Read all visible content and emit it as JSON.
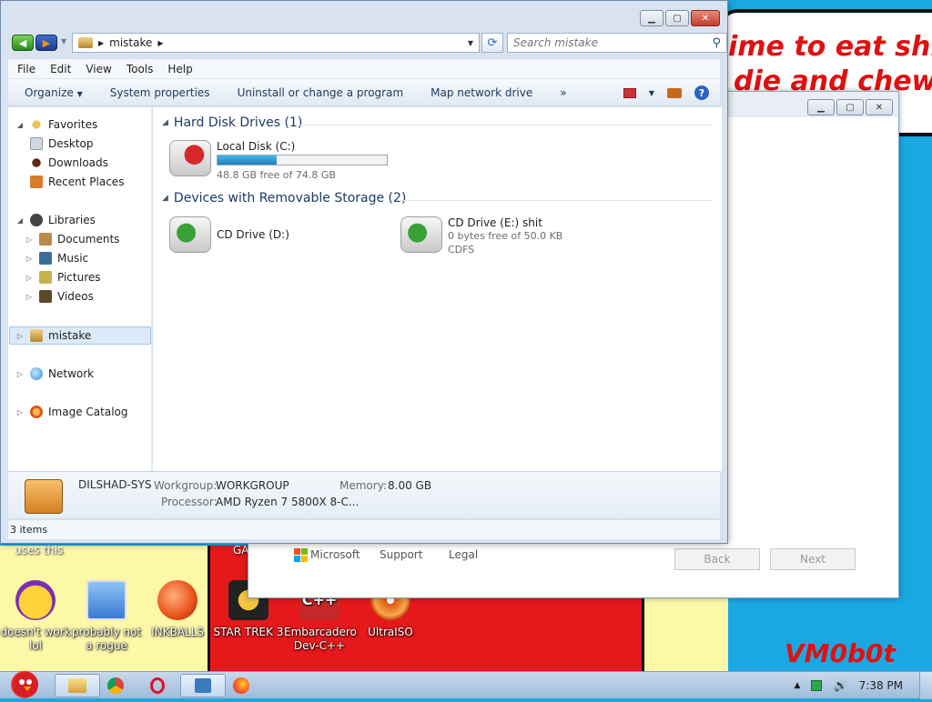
{
  "desktop": {
    "wallpaper_text_line1": "ime to eat shit",
    "wallpaper_text_line2": "die and chew",
    "watermark": "VM0b0t",
    "partial_label_left": "uses this",
    "partial_label_mid": "GA",
    "icons": [
      {
        "label": "doesn't work lol",
        "icon": "yahoo-messenger-icon",
        "color": "#7b2fb3"
      },
      {
        "label": "probably not a rogue",
        "icon": "gear-monitor-icon",
        "color": "#3a7bd5"
      },
      {
        "label": "INKBALLS",
        "icon": "inkball-icon",
        "color": "#e8501a"
      },
      {
        "label": "STAR TREK 3",
        "icon": "star-wars-icon",
        "color": "#222222"
      },
      {
        "label": "Embarcadero Dev-C++",
        "icon": "cpp-icon",
        "color": "#c62828"
      },
      {
        "label": "UltraISO",
        "icon": "disc-icon",
        "color": "#e05a12"
      }
    ]
  },
  "wizard": {
    "microsoft": "Microsoft",
    "support": "Support",
    "legal": "Legal",
    "back": "Back",
    "next": "Next"
  },
  "explorer": {
    "address": "mistake",
    "search_placeholder": "Search mistake",
    "menu": [
      "File",
      "Edit",
      "View",
      "Tools",
      "Help"
    ],
    "commands": [
      "Organize",
      "System properties",
      "Uninstall or change a program",
      "Map network drive",
      "»"
    ],
    "nav": {
      "favorites": "Favorites",
      "desktop": "Desktop",
      "downloads": "Downloads",
      "recent": "Recent Places",
      "libraries": "Libraries",
      "documents": "Documents",
      "music": "Music",
      "pictures": "Pictures",
      "videos": "Videos",
      "computer": "mistake",
      "network": "Network",
      "image_catalog": "Image Catalog"
    },
    "groups": {
      "hdd": "Hard Disk Drives (1)",
      "removable": "Devices with Removable Storage (2)"
    },
    "drives": {
      "c_name": "Local Disk (C:)",
      "c_free": "48.8 GB free of 74.8 GB",
      "c_used_fraction": 0.35,
      "d_name": "CD Drive (D:)",
      "e_name": "CD Drive (E:) shit",
      "e_free": "0 bytes free of 50.0 KB",
      "e_fs": "CDFS"
    },
    "details": {
      "pc_name": "DILSHAD-SYS",
      "workgroup_label": "Workgroup:",
      "workgroup": "WORKGROUP",
      "memory_label": "Memory:",
      "memory": "8.00 GB",
      "processor_label": "Processor:",
      "processor": "AMD Ryzen 7 5800X 8-C..."
    },
    "status": "3 items"
  },
  "taskbar": {
    "clock": "7:38 PM"
  }
}
